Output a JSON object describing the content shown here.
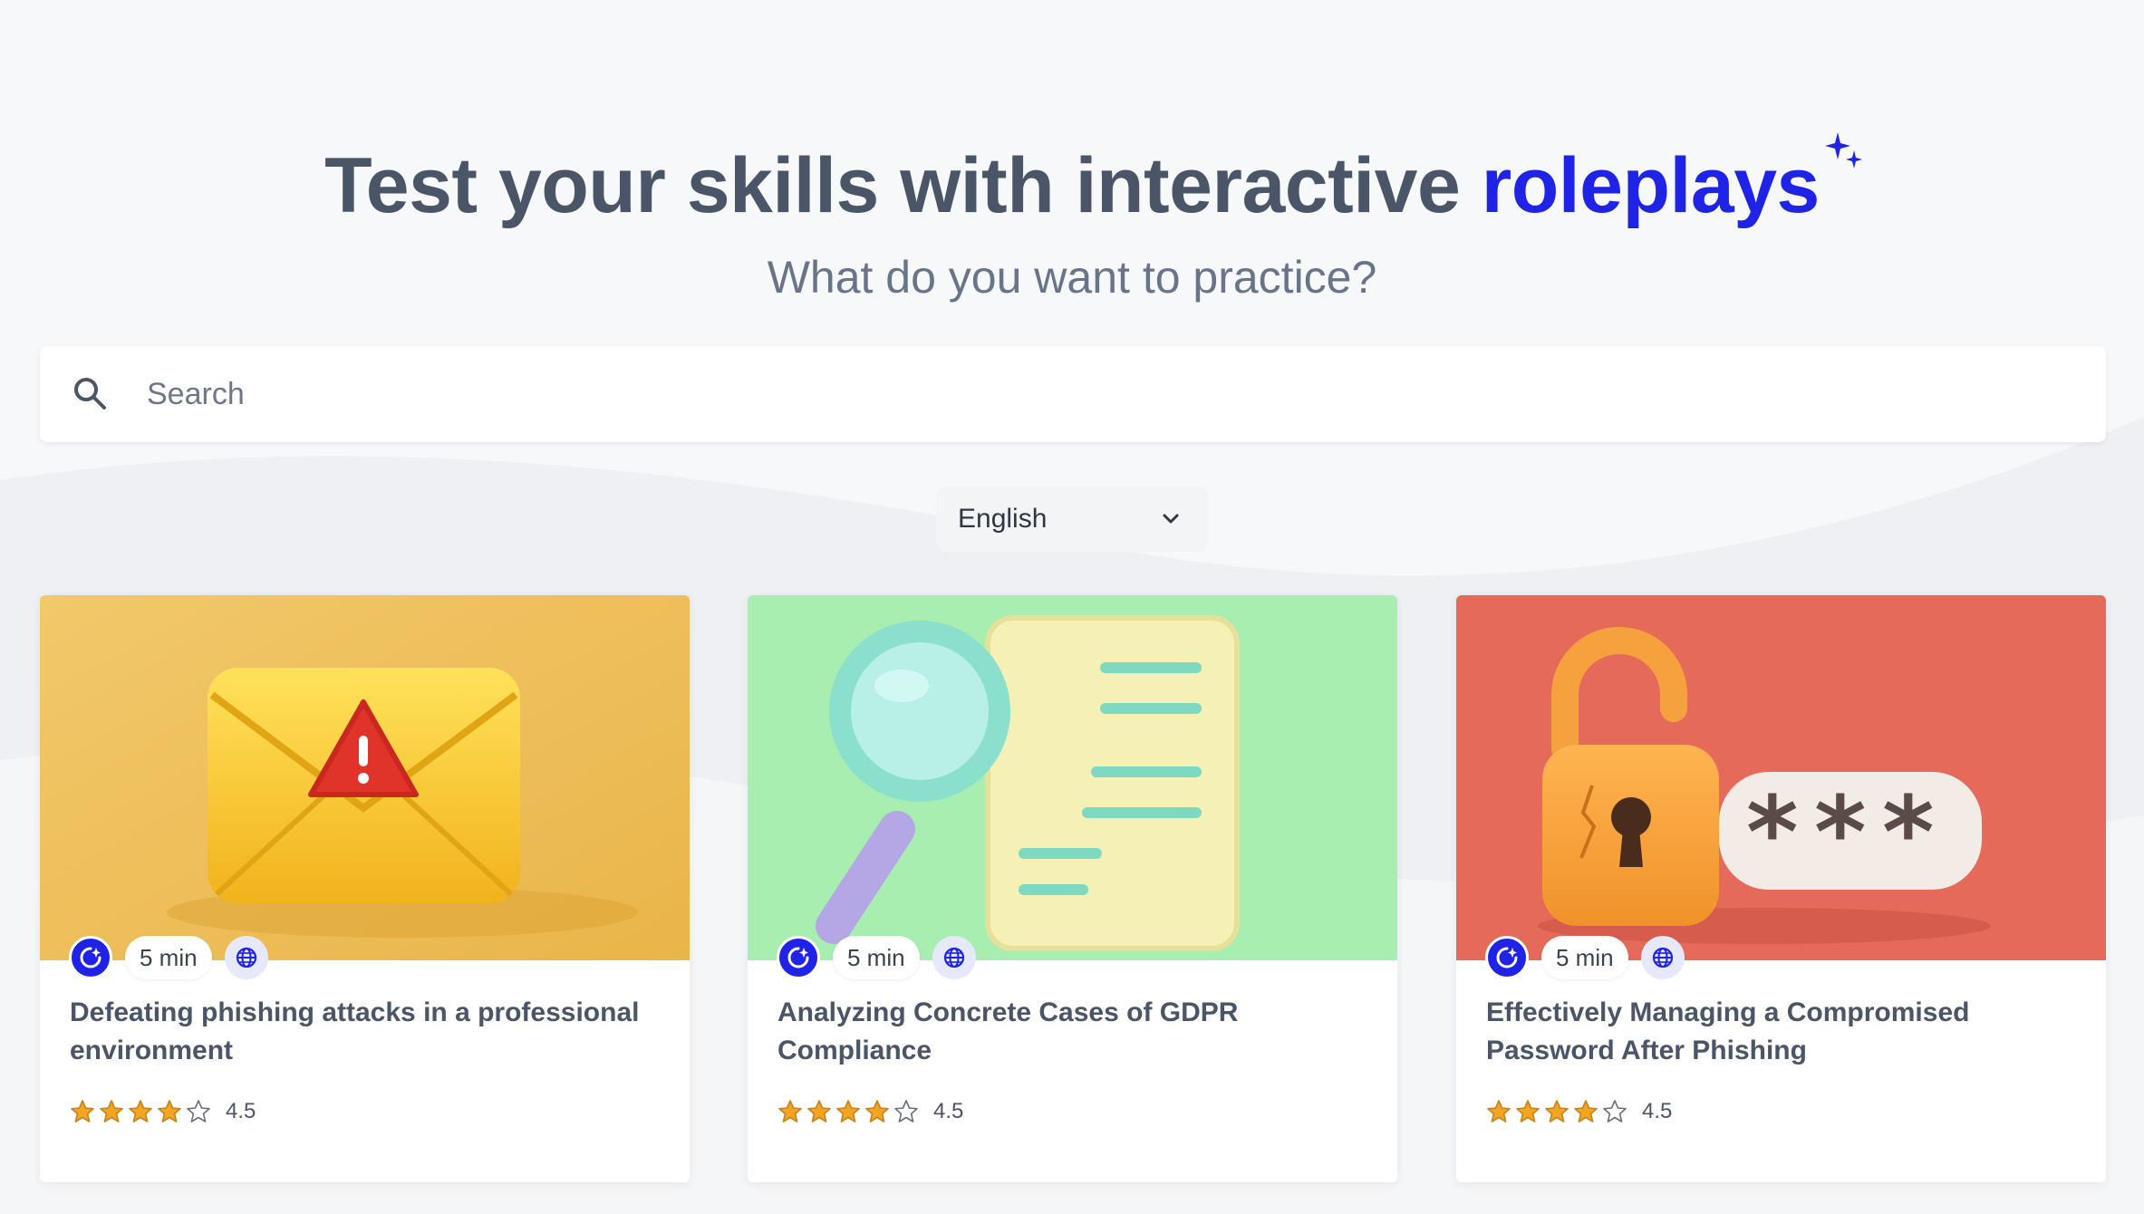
{
  "hero": {
    "title_main": "Test your skills with interactive ",
    "title_accent": "roleplays",
    "subtitle": "What do you want to practice?"
  },
  "search": {
    "placeholder": "Search",
    "value": ""
  },
  "language_select": {
    "selected": "English"
  },
  "colors": {
    "accent": "#1f23e6",
    "star": "#f0a623",
    "title": "#4a5567"
  },
  "cards": [
    {
      "title": "Defeating phishing attacks in a professional environment",
      "duration": "5 min",
      "rating_text": "4.5",
      "rating": 4.5
    },
    {
      "title": "Analyzing Concrete Cases of GDPR Compliance",
      "duration": "5 min",
      "rating_text": "4.5",
      "rating": 4.5
    },
    {
      "title": "Effectively Managing a Compromised Password After Phishing",
      "duration": "5 min",
      "rating_text": "4.5",
      "rating": 4.5
    }
  ]
}
